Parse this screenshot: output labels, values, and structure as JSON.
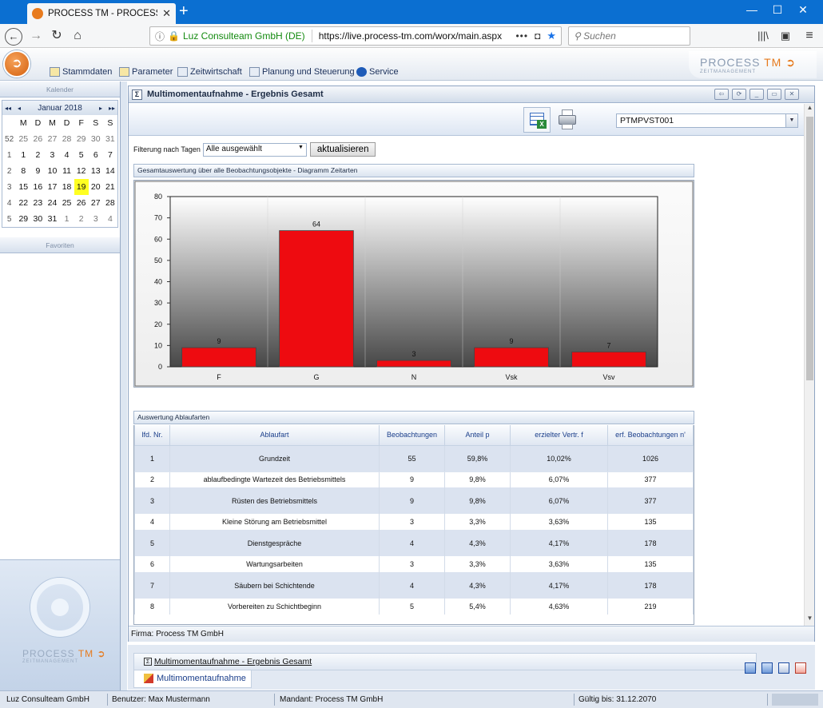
{
  "browser": {
    "tab_title": "PROCESS TM - PROCESS SUITE",
    "url_org": "Luz Consulteam GmbH (DE)",
    "url": "https://live.process-tm.com/worx/main.aspx",
    "search_placeholder": "Suchen",
    "more": "•••"
  },
  "app": {
    "menu": [
      "Stammdaten",
      "Parameter",
      "Zeitwirtschaft",
      "Planung und Steuerung",
      "Service"
    ],
    "brand_main": "PROCESS",
    "brand_tm": "TM",
    "brand_sub": "ZEITMANAGEMENT"
  },
  "left": {
    "calendar_header": "Kalender",
    "month": "Januar 2018",
    "weekdays": [
      "M",
      "D",
      "M",
      "D",
      "F",
      "S",
      "S"
    ],
    "weeks": [
      {
        "wk": "52",
        "days": [
          "25",
          "26",
          "27",
          "28",
          "29",
          "30",
          "31"
        ],
        "other": [
          true,
          true,
          true,
          true,
          true,
          true,
          true
        ]
      },
      {
        "wk": "1",
        "days": [
          "1",
          "2",
          "3",
          "4",
          "5",
          "6",
          "7"
        ],
        "other": [
          false,
          false,
          false,
          false,
          false,
          false,
          false
        ]
      },
      {
        "wk": "2",
        "days": [
          "8",
          "9",
          "10",
          "11",
          "12",
          "13",
          "14"
        ],
        "other": [
          false,
          false,
          false,
          false,
          false,
          false,
          false
        ]
      },
      {
        "wk": "3",
        "days": [
          "15",
          "16",
          "17",
          "18",
          "19",
          "20",
          "21"
        ],
        "other": [
          false,
          false,
          false,
          false,
          false,
          false,
          false
        ]
      },
      {
        "wk": "4",
        "days": [
          "22",
          "23",
          "24",
          "25",
          "26",
          "27",
          "28"
        ],
        "other": [
          false,
          false,
          false,
          false,
          false,
          false,
          false
        ]
      },
      {
        "wk": "5",
        "days": [
          "29",
          "30",
          "31",
          "1",
          "2",
          "3",
          "4"
        ],
        "other": [
          false,
          false,
          false,
          true,
          true,
          true,
          true
        ]
      }
    ],
    "today": "19",
    "favorites_header": "Favoriten",
    "logo_main": "PROCESS",
    "logo_tm": "TM",
    "logo_sub": "ZEITMANAGEMENT"
  },
  "window": {
    "title": "Multimomentaufnahme - Ergebnis Gesamt",
    "object_select": "PTMPVST001",
    "filter_label": "Filterung nach Tagen",
    "filter_value": "Alle ausgewählt",
    "refresh_label": "aktualisieren",
    "chart_panel_title": "Gesamtauswertung über alle Beobachtungsobjekte - Diagramm Zeitarten",
    "table_panel_title": "Auswertung Ablaufarten",
    "firma": "Firma: Process TM GmbH"
  },
  "chart_data": {
    "type": "bar",
    "categories": [
      "F",
      "G",
      "N",
      "Vsk",
      "Vsv"
    ],
    "values": [
      9,
      64,
      3,
      9,
      7
    ],
    "data_labels": [
      "9",
      "64",
      "3",
      "9",
      "7"
    ],
    "ylim": [
      0,
      80
    ],
    "yticks": [
      "0",
      "10",
      "20",
      "30",
      "40",
      "50",
      "60",
      "70",
      "80"
    ],
    "bar_color": "#ee0b10",
    "grid": true
  },
  "table": {
    "headers": [
      "lfd. Nr.",
      "Ablaufart",
      "Beobachtungen",
      "Anteil p",
      "erzielter Vertr. f",
      "erf. Beobachtungen n'"
    ],
    "rows": [
      [
        "1",
        "Grundzeit",
        "55",
        "59,8%",
        "10,02%",
        "1026"
      ],
      [
        "2",
        "ablaufbedingte Wartezeit des Betriebsmittels",
        "9",
        "9,8%",
        "6,07%",
        "377"
      ],
      [
        "3",
        "Rüsten des Betriebsmittels",
        "9",
        "9,8%",
        "6,07%",
        "377"
      ],
      [
        "4",
        "Kleine Störung am Betriebsmittel",
        "3",
        "3,3%",
        "3,63%",
        "135"
      ],
      [
        "5",
        "Dienstgespräche",
        "4",
        "4,3%",
        "4,17%",
        "178"
      ],
      [
        "6",
        "Wartungsarbeiten",
        "3",
        "3,3%",
        "3,63%",
        "135"
      ],
      [
        "7",
        "Säubern bei Schichtende",
        "4",
        "4,3%",
        "4,17%",
        "178"
      ],
      [
        "8",
        "Vorbereiten zu Schichtbeginn",
        "5",
        "5,4%",
        "4,63%",
        "219"
      ]
    ]
  },
  "tasks": {
    "task1": "Multimomentaufnahme - Ergebnis Gesamt",
    "task2": "Multimomentaufnahme"
  },
  "status": {
    "company": "Luz Consulteam GmbH",
    "user": "Benutzer: Max Mustermann",
    "mandant": "Mandant: Process TM GmbH",
    "valid": "Gültig bis: 31.12.2070"
  }
}
